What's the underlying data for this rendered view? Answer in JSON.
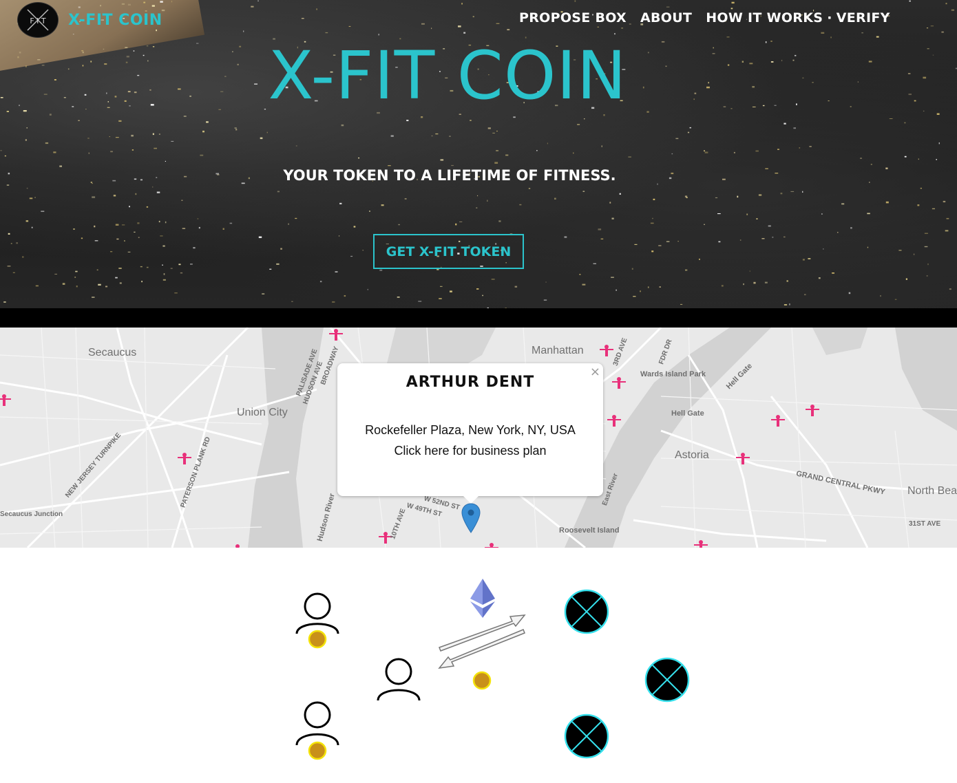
{
  "brand": {
    "name": "X-FIT COIN",
    "logo_letters": "F I T"
  },
  "nav": {
    "items": [
      "PROPOSE BOX",
      "ABOUT",
      "HOW IT WORKS",
      "VERIFY"
    ],
    "separator": "·"
  },
  "hero": {
    "title": "X-FIT COIN",
    "tagline": "YOUR TOKEN TO A LIFETIME OF FITNESS.",
    "cta_label": "GET X-FIT TOKEN"
  },
  "map": {
    "labels": {
      "secaucus": "Secaucus",
      "union_city": "Union City",
      "manhattan": "Manhattan",
      "astoria": "Astoria",
      "north_beach": "North Bea",
      "hell_gate": "Hell Gate",
      "hell_gate_road": "Hell Gate",
      "wards_island_park": "Wards Island Park",
      "roosevelt_island": "Roosevelt Island",
      "grand_central_pkwy": "GRAND CENTRAL PKWY",
      "secaucus_junction": "Secaucus Junction",
      "hudson_river": "Hudson River",
      "new_jersey_turnpike": "NEW JERSEY TURNPIKE",
      "paterson_plank_rd": "PATERSON PLANK RD",
      "palisade_ave": "PALISADE AVE",
      "hudson_ave": "HUDSON AVE",
      "broadway": "BROADWAY",
      "w_52nd_st": "W 52ND ST",
      "w_49th_st": "W 49TH ST",
      "tenth_ave": "10TH AVE",
      "third_ave": "3RD AVE",
      "fdr_dr": "FDR DR",
      "thirty_first_ave": "31ST AVE",
      "east_river": "East River"
    },
    "popup": {
      "name": "ARTHUR DENT",
      "address": "Rockefeller Plaza, New York, NY, USA",
      "link": "Click here for business plan",
      "close": "×"
    },
    "marker_color": "#e8307a",
    "pin_color": "#3a8fd6"
  },
  "diagram": {
    "users": [
      "user-top",
      "user-middle",
      "user-bottom"
    ],
    "coin_color": "#c8901a",
    "box_color": "#000000",
    "box_ring_color": "#35e0ec",
    "ethereum_color": "#6b7fd0"
  },
  "colors": {
    "accent": "#2bc4cc"
  }
}
